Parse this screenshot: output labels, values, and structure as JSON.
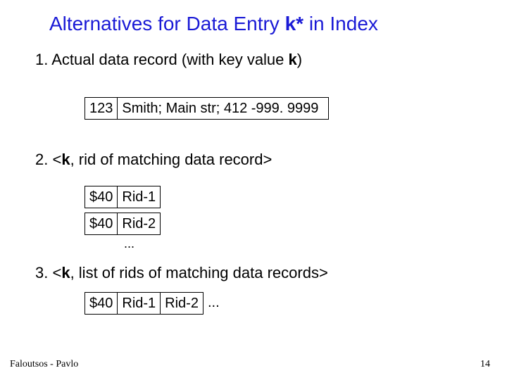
{
  "title_pre": "Alternatives for Data Entry ",
  "title_k": "k*",
  "title_post": " in Index",
  "item1_pre": "1.  Actual data record (with key value ",
  "item1_k": "k",
  "item1_post": ")",
  "row1_c1": "123",
  "row1_c2": "Smith;   Main str;  412 -999. 9999",
  "item2_pre": "2. <",
  "item2_k": "k",
  "item2_post": ", rid of matching data record>",
  "row2a_c1": "$40",
  "row2a_c2": "Rid-1",
  "row2b_c1": "$40",
  "row2b_c2": "Rid-2",
  "dots2": "...",
  "item3_pre": "3. <",
  "item3_k": "k",
  "item3_post": ", list of rids of matching data records>",
  "row3_c1": "$40",
  "row3_c2": "Rid-1",
  "row3_c3": "Rid-2",
  "row3_after": "...",
  "footer_left": "Faloutsos - Pavlo",
  "footer_right": "14"
}
